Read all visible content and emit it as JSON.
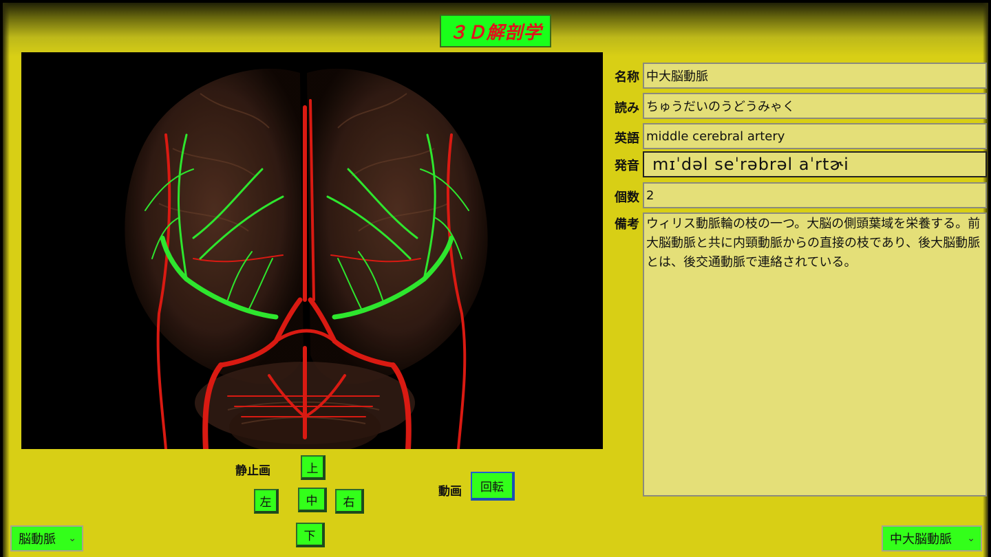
{
  "header": {
    "title": "３Ｄ解剖学"
  },
  "viewer": {
    "subject": "脳動脈"
  },
  "fields": {
    "name": {
      "label": "名称",
      "value": "中大脳動脈"
    },
    "reading": {
      "label": "読み",
      "value": "ちゅうだいのうどうみゃく"
    },
    "english": {
      "label": "英語",
      "value": "middle cerebral artery"
    },
    "pronunciation": {
      "label": "発音",
      "value": "mɪˈdəl seˈrəbrəl aˈrtɚi"
    },
    "count": {
      "label": "個数",
      "value": "2"
    },
    "notes": {
      "label": "備考",
      "value": "ウィリス動脈輪の枝の一つ。大脳の側頭葉域を栄養する。前大脳動脈と共に内頸動脈からの直接の枝であり、後大脳動脈とは、後交通動脈で連絡されている。"
    }
  },
  "controls": {
    "still_label": "静止画",
    "up": "上",
    "left": "左",
    "center": "中",
    "right": "右",
    "down": "下",
    "animation_label": "動画",
    "rotate": "回転"
  },
  "selectors": {
    "category": {
      "value": "脳動脈"
    },
    "structure": {
      "value": "中大脳動脈"
    }
  },
  "colors": {
    "background": "#d8cf15",
    "button": "#33ff1a",
    "title_text": "#e2121b",
    "field_bg": "#e4df78",
    "highlight_artery": "#2ee62e",
    "other_arteries": "#d91a12"
  },
  "icons": {
    "dropdown": "chevron-down-icon"
  }
}
